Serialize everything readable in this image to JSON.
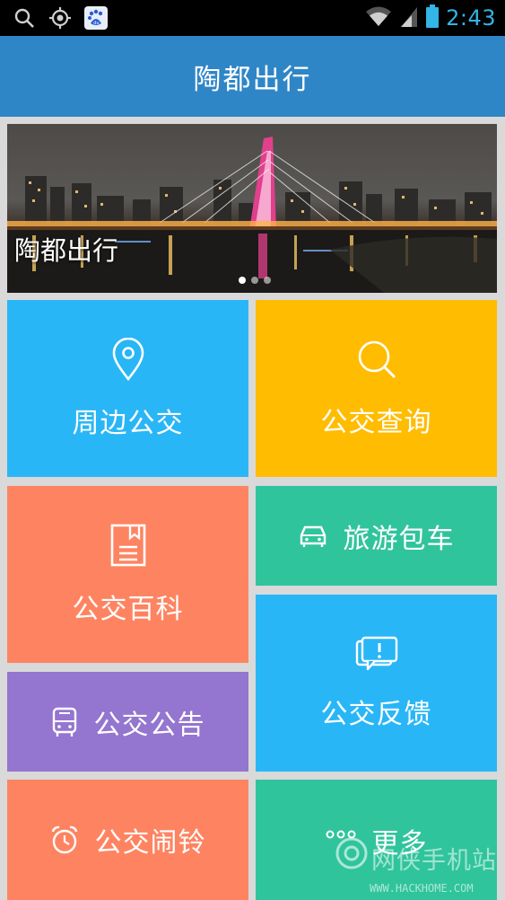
{
  "status_bar": {
    "time": "2:43",
    "icons": [
      "search-icon",
      "gps-icon",
      "baidu-icon",
      "wifi-icon",
      "signal-icon",
      "battery-icon"
    ]
  },
  "header": {
    "title": "陶都出行"
  },
  "banner": {
    "caption": "陶都出行",
    "page_count": 3,
    "active_page": 1
  },
  "tiles": {
    "nearby_bus": {
      "label": "周边公交",
      "icon": "location-pin-icon",
      "color": "#29b6f6"
    },
    "bus_query": {
      "label": "公交查询",
      "icon": "search-icon",
      "color": "#ffbc00"
    },
    "bus_encyclopedia": {
      "label": "公交百科",
      "icon": "book-icon",
      "color": "#fe8461"
    },
    "charter": {
      "label": "旅游包车",
      "icon": "car-icon",
      "color": "#30c49c"
    },
    "feedback": {
      "label": "公交反馈",
      "icon": "chat-alert-icon",
      "color": "#29b6f6"
    },
    "notice": {
      "label": "公交公告",
      "icon": "bus-icon",
      "color": "#9475cf"
    },
    "alarm": {
      "label": "公交闹铃",
      "icon": "alarm-clock-icon",
      "color": "#fe8461"
    },
    "more": {
      "label": "更多",
      "icon": "more-dots-icon",
      "color": "#30c49c"
    }
  },
  "watermark": {
    "text": "网侠手机站",
    "url": "WWW.HACKHOME.COM"
  }
}
